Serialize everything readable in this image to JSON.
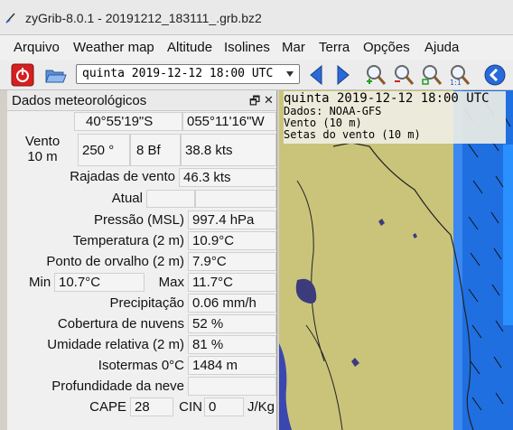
{
  "window": {
    "title": "zyGrib-8.0.1 - 20191212_183111_.grb.bz2"
  },
  "menu": [
    "Arquivo",
    "Weather map",
    "Altitude",
    "Isolines",
    "Mar",
    "Terra",
    "Opções",
    "Ajuda"
  ],
  "toolbar": {
    "selected_date": "quinta 2019-12-12 18:00 UTC",
    "icons": [
      "power-icon",
      "open-folder-icon",
      "prev-arrow-icon",
      "next-arrow-icon",
      "zoom-in-icon",
      "zoom-out-icon",
      "zoom-area-icon",
      "zoom-reset-icon",
      "back-icon"
    ]
  },
  "panel": {
    "title": "Dados meteorológicos",
    "lat": "40°55'19\"S",
    "lon": "055°11'16\"W",
    "wind_label_1": "Vento",
    "wind_label_2": "10 m",
    "wind_dir": "250 °",
    "wind_bf": "8 Bf",
    "wind_speed": "38.8  kts",
    "gust_label": "Rajadas de vento",
    "gust_value": "46.3  kts",
    "atual_label": "Atual",
    "pressure_label": "Pressão (MSL)",
    "pressure_value": "997.4 hPa",
    "temp_label": "Temperatura (2 m)",
    "temp_value": "10.9°C",
    "dew_label": "Ponto de orvalho (2 m)",
    "dew_value": "7.9°C",
    "min_label": "Min",
    "min_value": "10.7°C",
    "max_label": "Max",
    "max_value": "11.7°C",
    "precip_label": "Precipitação",
    "precip_value": "0.06 mm/h",
    "cloud_label": "Cobertura de nuvens",
    "cloud_value": "52 %",
    "humidity_label": "Umidade relativa (2 m)",
    "humidity_value": "81 %",
    "iso_label": "Isotermas 0°C",
    "iso_value": "1484 m",
    "snow_label": "Profundidade da neve",
    "cape_label": "CAPE",
    "cape_value": "28",
    "cin_label": "CIN",
    "cin_value": "0",
    "cape_unit": "J/Kg"
  },
  "map": {
    "date": "quinta 2019-12-12 18:00 UTC",
    "source": "Dados: NOAA-GFS",
    "layer": "Vento (10 m)",
    "arrows": "Setas do vento (10 m)",
    "colors": {
      "land": "#c9c47a",
      "ocean": "#1f6fe0",
      "lake": "#3c3c7c"
    }
  }
}
